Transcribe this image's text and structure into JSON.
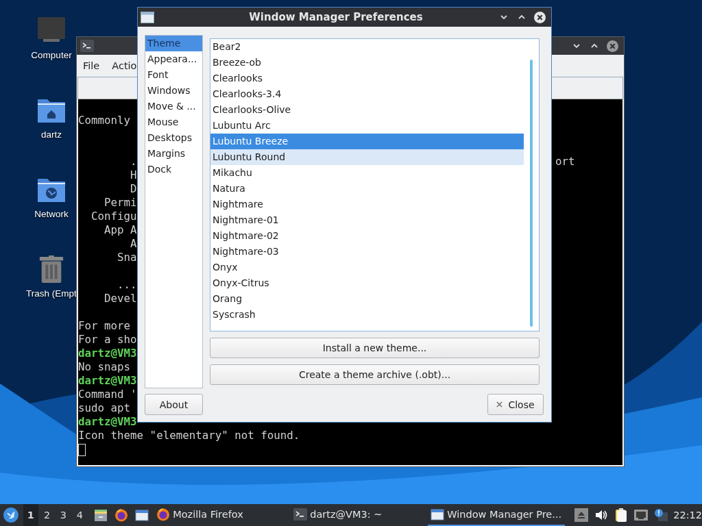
{
  "desktop": {
    "icons": [
      {
        "label": "Computer",
        "kind": "computer"
      },
      {
        "label": "dartz",
        "kind": "home"
      },
      {
        "label": "Network",
        "kind": "network"
      },
      {
        "label": "Trash (Empt",
        "kind": "trash"
      }
    ]
  },
  "terminal": {
    "menu": [
      "File",
      "Actio"
    ],
    "lines": [
      {
        "kind": "blank"
      },
      {
        "kind": "text",
        "text": "Commonly"
      },
      {
        "kind": "blank"
      },
      {
        "kind": "blank"
      },
      {
        "kind": "text",
        "text": "        .",
        "right": "ort"
      },
      {
        "kind": "text",
        "text": "        H"
      },
      {
        "kind": "text",
        "text": "        D"
      },
      {
        "kind": "text",
        "text": "    Permi"
      },
      {
        "kind": "text",
        "text": "  Configu"
      },
      {
        "kind": "text",
        "text": "    App A"
      },
      {
        "kind": "text",
        "text": "        A"
      },
      {
        "kind": "text",
        "text": "      Sna"
      },
      {
        "kind": "blank"
      },
      {
        "kind": "text",
        "text": "      ..."
      },
      {
        "kind": "text",
        "text": "    Devel"
      },
      {
        "kind": "blank"
      },
      {
        "kind": "text",
        "text": "For more"
      },
      {
        "kind": "text",
        "text": "For a sho"
      },
      {
        "kind": "prompt",
        "prompt": "dartz@VM3"
      },
      {
        "kind": "text",
        "text": "No snaps"
      },
      {
        "kind": "prompt",
        "prompt": "dartz@VM3"
      },
      {
        "kind": "text",
        "text": "Command '"
      },
      {
        "kind": "text",
        "text": "sudo apt"
      },
      {
        "kind": "prompt",
        "prompt": "dartz@VM3"
      },
      {
        "kind": "text",
        "text": "Icon theme \"elementary\" not found."
      },
      {
        "kind": "cursor"
      }
    ]
  },
  "dialog": {
    "title": "Window Manager Preferences",
    "sections": [
      {
        "label": "Theme",
        "selected": true
      },
      {
        "label": "Appeara...",
        "selected": false
      },
      {
        "label": "Font",
        "selected": false
      },
      {
        "label": "Windows",
        "selected": false
      },
      {
        "label": "Move & ...",
        "selected": false
      },
      {
        "label": "Mouse",
        "selected": false
      },
      {
        "label": "Desktops",
        "selected": false
      },
      {
        "label": "Margins",
        "selected": false
      },
      {
        "label": "Dock",
        "selected": false
      }
    ],
    "themes": [
      {
        "label": "Bear2",
        "selected": false,
        "hover": false
      },
      {
        "label": "Breeze-ob",
        "selected": false,
        "hover": false
      },
      {
        "label": "Clearlooks",
        "selected": false,
        "hover": false
      },
      {
        "label": "Clearlooks-3.4",
        "selected": false,
        "hover": false
      },
      {
        "label": "Clearlooks-Olive",
        "selected": false,
        "hover": false
      },
      {
        "label": "Lubuntu Arc",
        "selected": false,
        "hover": false
      },
      {
        "label": "Lubuntu Breeze",
        "selected": true,
        "hover": false
      },
      {
        "label": "Lubuntu Round",
        "selected": false,
        "hover": true
      },
      {
        "label": "Mikachu",
        "selected": false,
        "hover": false
      },
      {
        "label": "Natura",
        "selected": false,
        "hover": false
      },
      {
        "label": "Nightmare",
        "selected": false,
        "hover": false
      },
      {
        "label": "Nightmare-01",
        "selected": false,
        "hover": false
      },
      {
        "label": "Nightmare-02",
        "selected": false,
        "hover": false
      },
      {
        "label": "Nightmare-03",
        "selected": false,
        "hover": false
      },
      {
        "label": "Onyx",
        "selected": false,
        "hover": false
      },
      {
        "label": "Onyx-Citrus",
        "selected": false,
        "hover": false
      },
      {
        "label": "Orang",
        "selected": false,
        "hover": false
      },
      {
        "label": "Syscrash",
        "selected": false,
        "hover": false
      }
    ],
    "actions": [
      "Install a new theme...",
      "Create a theme archive (.obt)..."
    ],
    "about": "About",
    "close": "Close"
  },
  "taskbar": {
    "desktops": [
      {
        "label": "1",
        "selected": true
      },
      {
        "label": "2",
        "selected": false
      },
      {
        "label": "3",
        "selected": false
      },
      {
        "label": "4",
        "selected": false
      }
    ],
    "launchers": [
      {
        "kind": "files"
      },
      {
        "kind": "firefox"
      },
      {
        "kind": "window"
      }
    ],
    "tasks": [
      {
        "label": "Mozilla Firefox",
        "kind": "firefox",
        "active": false
      },
      {
        "label": "dartz@VM3: ~",
        "kind": "terminal",
        "active": false
      },
      {
        "label": "Window Manager Pre...",
        "kind": "window",
        "active": true
      }
    ],
    "tray": [
      {
        "kind": "eject"
      },
      {
        "kind": "volume"
      },
      {
        "kind": "notes"
      },
      {
        "kind": "network"
      },
      {
        "kind": "alert"
      }
    ],
    "clock": "22:12"
  }
}
